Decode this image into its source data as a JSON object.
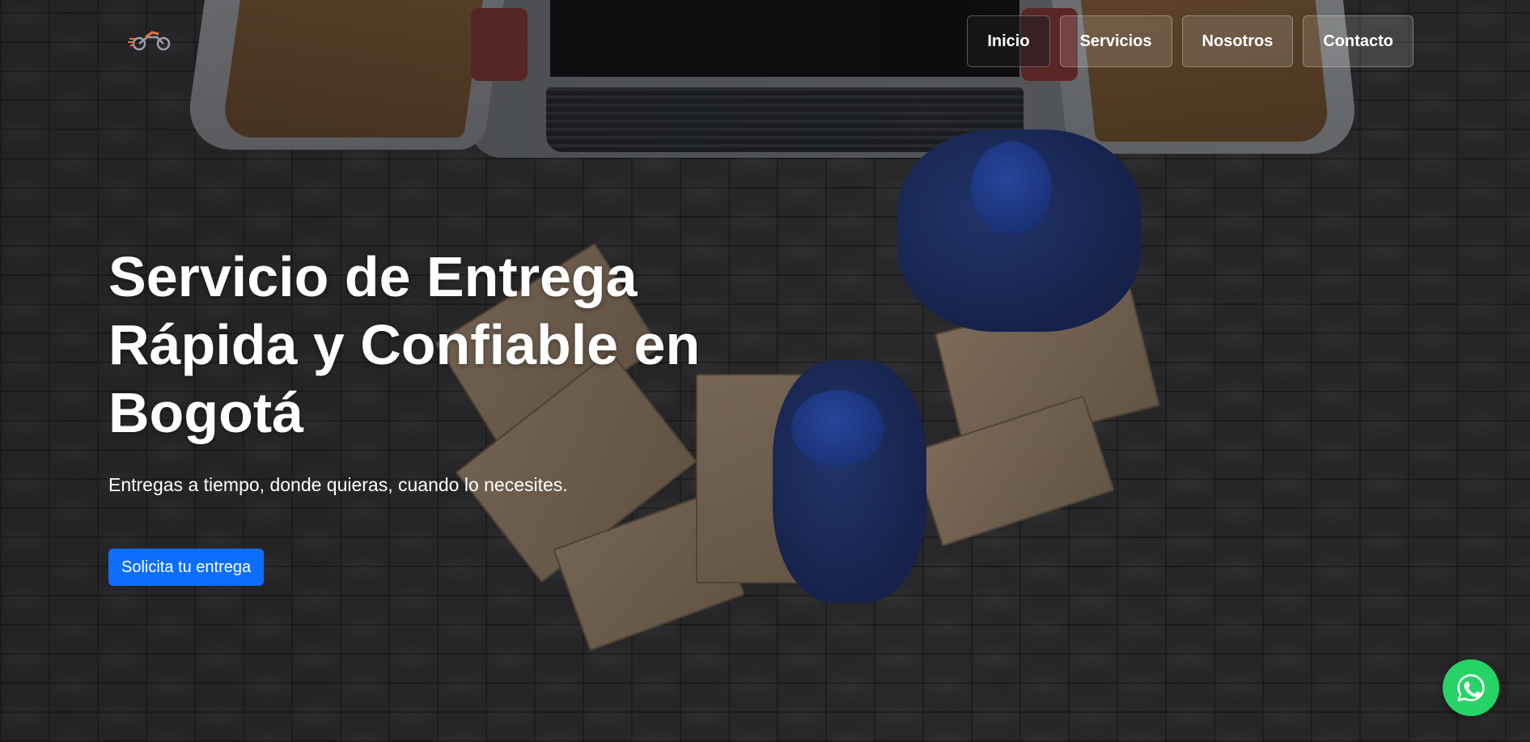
{
  "logo": {
    "icon": "motorcycle-icon",
    "accent_color": "#e8703a"
  },
  "nav": {
    "items": [
      {
        "label": "Inicio"
      },
      {
        "label": "Servicios"
      },
      {
        "label": "Nosotros"
      },
      {
        "label": "Contacto"
      }
    ]
  },
  "hero": {
    "title_line1": "Servicio de Entrega",
    "title_line2": "Rápida y Confiable en",
    "title_line3": "Bogotá",
    "subtitle": "Entregas a tiempo, donde quieras, cuando lo necesites.",
    "cta_label": "Solicita tu entrega",
    "cta_color": "#0d6efd"
  },
  "whatsapp": {
    "icon": "whatsapp-icon",
    "color": "#25d366"
  }
}
